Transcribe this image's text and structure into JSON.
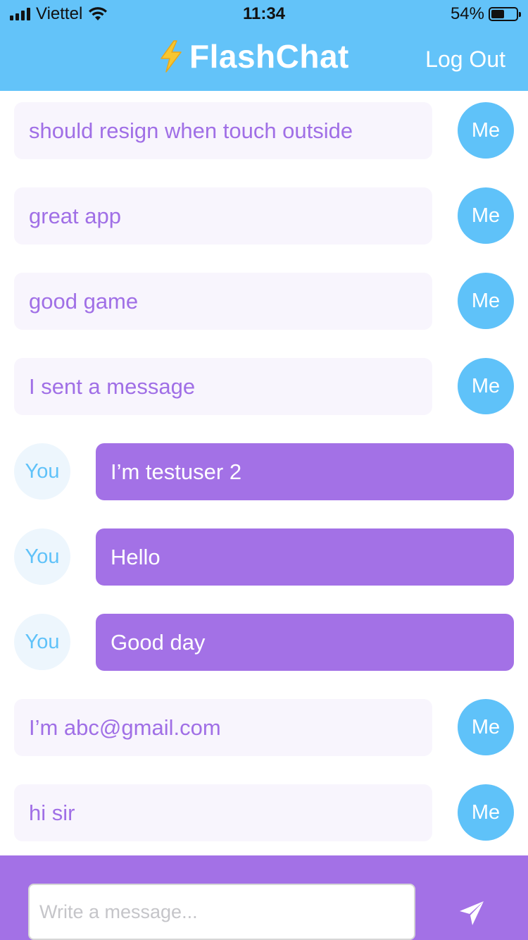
{
  "status_bar": {
    "carrier": "Viettel",
    "time": "11:34",
    "battery_percent": "54%",
    "battery_level": 0.54,
    "signal_icon": "cellular-signal-icon",
    "wifi_icon": "wifi-icon",
    "battery_icon": "battery-icon"
  },
  "header": {
    "title_icon": "lightning-bolt-icon",
    "title": "FlashChat",
    "logout_label": "Log Out"
  },
  "messages": [
    {
      "sender": "me",
      "text": "should resign when touch outside",
      "avatar_label": "Me"
    },
    {
      "sender": "me",
      "text": "great app",
      "avatar_label": "Me"
    },
    {
      "sender": "me",
      "text": "good game",
      "avatar_label": "Me"
    },
    {
      "sender": "me",
      "text": "I sent a message",
      "avatar_label": "Me"
    },
    {
      "sender": "you",
      "text": "I’m testuser 2",
      "avatar_label": "You"
    },
    {
      "sender": "you",
      "text": "Hello",
      "avatar_label": "You"
    },
    {
      "sender": "you",
      "text": "Good day",
      "avatar_label": "You"
    },
    {
      "sender": "me",
      "text": "I’m abc@gmail.com",
      "avatar_label": "Me"
    },
    {
      "sender": "me",
      "text": "hi sir",
      "avatar_label": "Me"
    }
  ],
  "composer": {
    "placeholder": "Write a message...",
    "value": "",
    "send_icon": "paper-plane-icon"
  },
  "colors": {
    "header_blue": "#63c3f9",
    "purple": "#a371e6",
    "me_bubble_bg": "#f8f5fd",
    "me_avatar_bg": "#5fc2f9",
    "you_avatar_bg": "#edf6fd"
  }
}
